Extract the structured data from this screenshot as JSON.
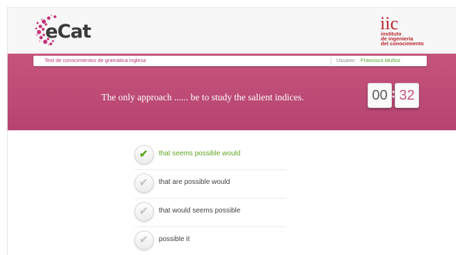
{
  "logo": {
    "text": "eCat"
  },
  "institution": {
    "mark": "iic",
    "lines": [
      "instituto",
      "de ingeniería",
      "del conocimiento"
    ]
  },
  "info_bar": {
    "test_title": "Test de conocimientos de gramática inglesa",
    "user_label": "Usuario:",
    "user_name": "Francisco Muñoz"
  },
  "question": "The only approach ...... be to study the salient indices.",
  "timer": {
    "minutes": "00",
    "seconds": "32"
  },
  "answers": [
    {
      "label": "that seems possible would",
      "selected": true
    },
    {
      "label": "that are possible would",
      "selected": false
    },
    {
      "label": "that would seems possible",
      "selected": false
    },
    {
      "label": "possible it",
      "selected": false
    }
  ],
  "colors": {
    "brand_pink": "#c5547d",
    "iic_red": "#b8242c",
    "selected_green": "#5ea51f"
  }
}
